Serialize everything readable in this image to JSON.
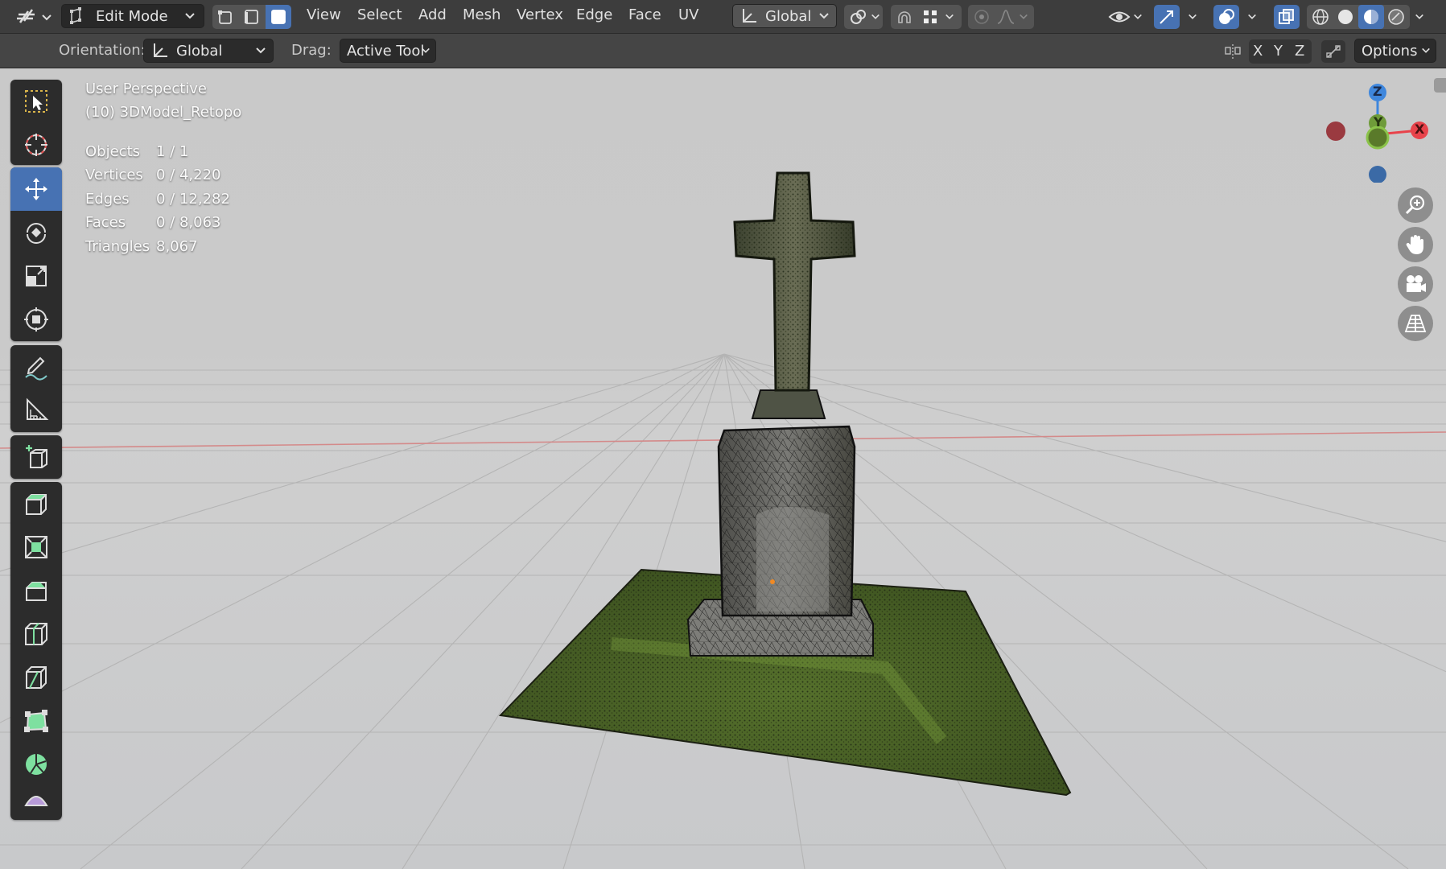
{
  "header": {
    "mode": "Edit Mode",
    "menus": [
      "View",
      "Select",
      "Add",
      "Mesh",
      "Vertex",
      "Edge",
      "Face",
      "UV"
    ],
    "transform_orientation": "Global"
  },
  "tool_settings": {
    "orientation_label": "Orientation:",
    "orientation_value": "Global",
    "drag_label": "Drag:",
    "drag_value": "Active Tool",
    "axis_x": "X",
    "axis_y": "Y",
    "axis_z": "Z",
    "options_label": "Options"
  },
  "viewport": {
    "view_name": "User Perspective",
    "object_name": "(10) 3DModel_Retopo",
    "stats": [
      {
        "label": "Objects",
        "value": "1 / 1"
      },
      {
        "label": "Vertices",
        "value": "0 / 4,220"
      },
      {
        "label": "Edges",
        "value": "0 / 12,282"
      },
      {
        "label": "Faces",
        "value": "0 / 8,063"
      },
      {
        "label": "Triangles",
        "value": "8,067"
      }
    ]
  },
  "gizmo": {
    "z": "Z",
    "y": "Y",
    "x": "X"
  },
  "icons": {
    "toolbar": [
      "select-box-icon",
      "cursor-icon",
      "move-icon",
      "rotate-icon",
      "scale-icon",
      "transform-icon",
      "annotate-icon",
      "measure-icon",
      "add-cube-icon",
      "extrude-region-icon",
      "inset-faces-icon",
      "bevel-icon",
      "loop-cut-icon",
      "knife-icon",
      "poly-build-icon",
      "spin-icon",
      "smooth-icon"
    ],
    "nav": [
      "zoom-icon",
      "hand-pan-icon",
      "camera-icon",
      "ortho-grid-icon"
    ]
  },
  "colors": {
    "accent": "#4772b3",
    "axis_x": "#e8434b",
    "axis_y": "#8bc34a",
    "axis_z": "#3f87dd",
    "header": "#3d3d3d",
    "viewport": "#c9c9c9"
  }
}
